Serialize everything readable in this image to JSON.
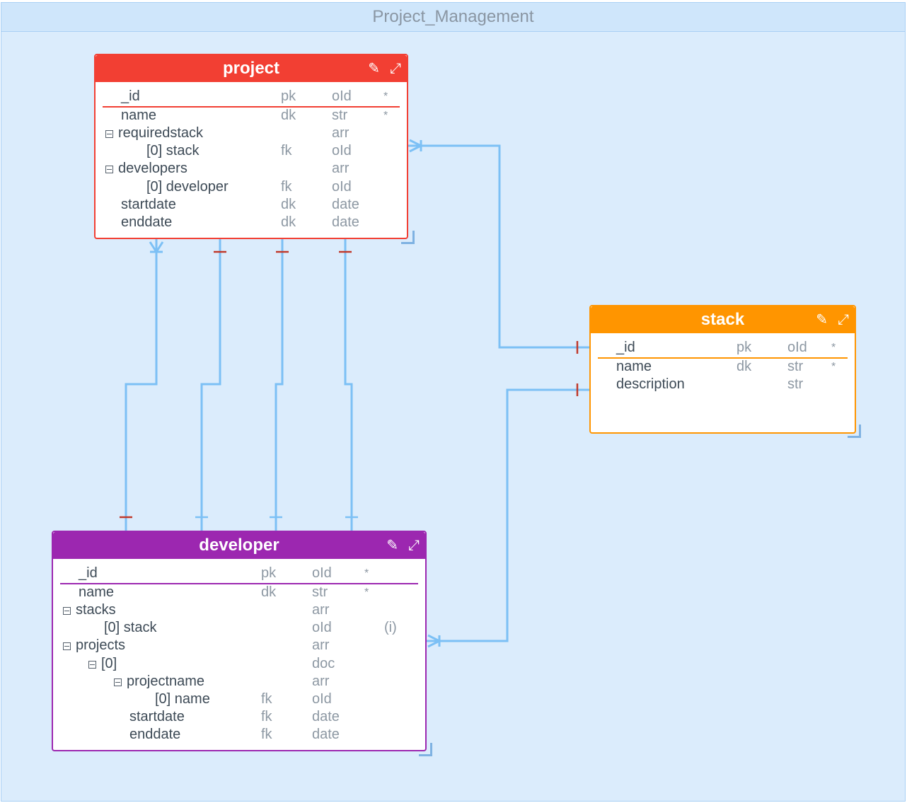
{
  "container": {
    "title": "Project_Management"
  },
  "colors": {
    "project": "#f23f33",
    "stack": "#ff9500",
    "developer": "#9c27b0",
    "link": "#7cc0f5",
    "tick": "#c0392b"
  },
  "icons": {
    "edit": "pencil-icon",
    "expand": "expand-icon"
  },
  "entities": {
    "project": {
      "title": "project",
      "fields": [
        {
          "name": "_id",
          "key": "pk",
          "type": "oId",
          "flag": "*"
        },
        {
          "name": "name",
          "key": "dk",
          "type": "str",
          "flag": "*"
        },
        {
          "name": "requiredstack",
          "key": "",
          "type": "arr",
          "flag": ""
        },
        {
          "name": "[0] stack",
          "key": "fk",
          "type": "oId",
          "flag": ""
        },
        {
          "name": "developers",
          "key": "",
          "type": "arr",
          "flag": ""
        },
        {
          "name": "[0] developer",
          "key": "fk",
          "type": "oId",
          "flag": ""
        },
        {
          "name": "startdate",
          "key": "dk",
          "type": "date",
          "flag": ""
        },
        {
          "name": "enddate",
          "key": "dk",
          "type": "date",
          "flag": ""
        }
      ]
    },
    "stack": {
      "title": "stack",
      "fields": [
        {
          "name": "_id",
          "key": "pk",
          "type": "oId",
          "flag": "*"
        },
        {
          "name": "name",
          "key": "dk",
          "type": "str",
          "flag": "*"
        },
        {
          "name": "description",
          "key": "",
          "type": "str",
          "flag": ""
        }
      ]
    },
    "developer": {
      "title": "developer",
      "fields": [
        {
          "name": "_id",
          "key": "pk",
          "type": "oId",
          "flag": "*"
        },
        {
          "name": "name",
          "key": "dk",
          "type": "str",
          "flag": "*"
        },
        {
          "name": "stacks",
          "key": "",
          "type": "arr",
          "flag": ""
        },
        {
          "name": "[0] stack",
          "key": "",
          "type": "oId",
          "flag": "(i)"
        },
        {
          "name": "projects",
          "key": "",
          "type": "arr",
          "flag": ""
        },
        {
          "name": "[0]",
          "key": "",
          "type": "doc",
          "flag": ""
        },
        {
          "name": "projectname",
          "key": "",
          "type": "arr",
          "flag": ""
        },
        {
          "name": "[0] name",
          "key": "fk",
          "type": "oId",
          "flag": ""
        },
        {
          "name": "startdate",
          "key": "fk",
          "type": "date",
          "flag": ""
        },
        {
          "name": "enddate",
          "key": "fk",
          "type": "date",
          "flag": ""
        }
      ]
    }
  }
}
